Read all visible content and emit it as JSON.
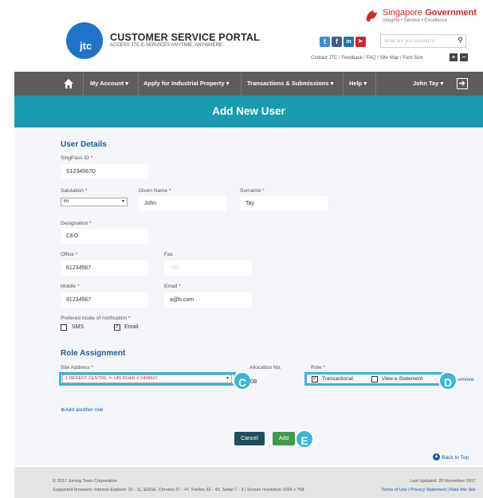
{
  "header": {
    "logo_text": "jtc",
    "portal_title": "CUSTOMER SERVICE PORTAL",
    "portal_subtitle": "ACCESS JTC E-SERVICES ANYTIME, ANYWHERE.",
    "gov_title_a": "Singapore ",
    "gov_title_b": "Government",
    "gov_tagline": "Integrity • Service • Excellence",
    "search_placeholder": "What are you looking fo",
    "util_links": "Contact JTC  / Feedback  / FAQ  / Site Map  / Font Size",
    "font_plus": "+",
    "font_minus": "−",
    "social": [
      {
        "icon": "twitter-icon",
        "glyph": "t",
        "color": "#3a8fd6"
      },
      {
        "icon": "facebook-icon",
        "glyph": "f",
        "color": "#3b5a9a"
      },
      {
        "icon": "linkedin-icon",
        "glyph": "in",
        "color": "#1f74b5"
      },
      {
        "icon": "youtube-icon",
        "glyph": "▶",
        "color": "#d0252a"
      }
    ]
  },
  "nav": {
    "items": [
      "My Account ▾",
      "Apply for Industrial Property ▾",
      "Transactions & Submissions ▾",
      "Help ▾",
      "John Tay ▾"
    ]
  },
  "page_title": "Add New User",
  "user_details": {
    "heading": "User Details",
    "singpass_label": "SingPass ID ",
    "singpass_value": "S1234567D",
    "salutation_label": "Salutation ",
    "salutation_value": "Mr",
    "given_label": "Given Name ",
    "given_value": "John",
    "surname_label": "Surname ",
    "surname_value": "Tay",
    "designation_label": "Designation ",
    "designation_value": "CEO",
    "office_label": "Office ",
    "office_value": "61234567",
    "fax_label": "Fax",
    "fax_placeholder": "+65",
    "mobile_label": "Mobile ",
    "mobile_value": "91234567",
    "email_label": "Email ",
    "email_value": "a@b.com",
    "notif_label": "Prefered mode of notification ",
    "sms_label": "SMS",
    "email_opt_label": "Email",
    "required_mark": "*"
  },
  "role_assignment": {
    "heading": "Role Assignment",
    "site_label": "Site Address ",
    "site_value": "1 REGENT CENTRE, #- UBI ROAD 4 S408607",
    "alloc_label": "Allocation No.",
    "alloc_value": "08",
    "role_label": "Role ",
    "role_transactional": "Transactional",
    "role_estatement": "View e-Statement",
    "remove_label": "emove",
    "add_another": "⊕Add another role"
  },
  "callouts": {
    "c": "C",
    "d": "D",
    "e": "E"
  },
  "buttons": {
    "cancel": "Cancel",
    "add": "Add"
  },
  "back_to_top": "Back to Top",
  "footer": {
    "copyright": "© 2017 Jurong Town Corporation",
    "browsers": "Supported browsers: Internet Explorer 10 - 11, EDGE, Chrome 37 - 47, Firefox 32 - 43, Safari 7 - 9 | Screen resolution 1024 x 768",
    "updated": "Last Updated: 20 November 2017",
    "links": "Terms of Use  |  Privacy Statement  |  Rate this Site"
  },
  "colors": {
    "brand_blue": "#1f73c9",
    "navbar": "#5d5d5d",
    "banner_teal": "#1a9cb0",
    "highlight": "#3bb4d9",
    "cancel_btn": "#1d4f5c",
    "add_btn": "#3f9a4a"
  }
}
